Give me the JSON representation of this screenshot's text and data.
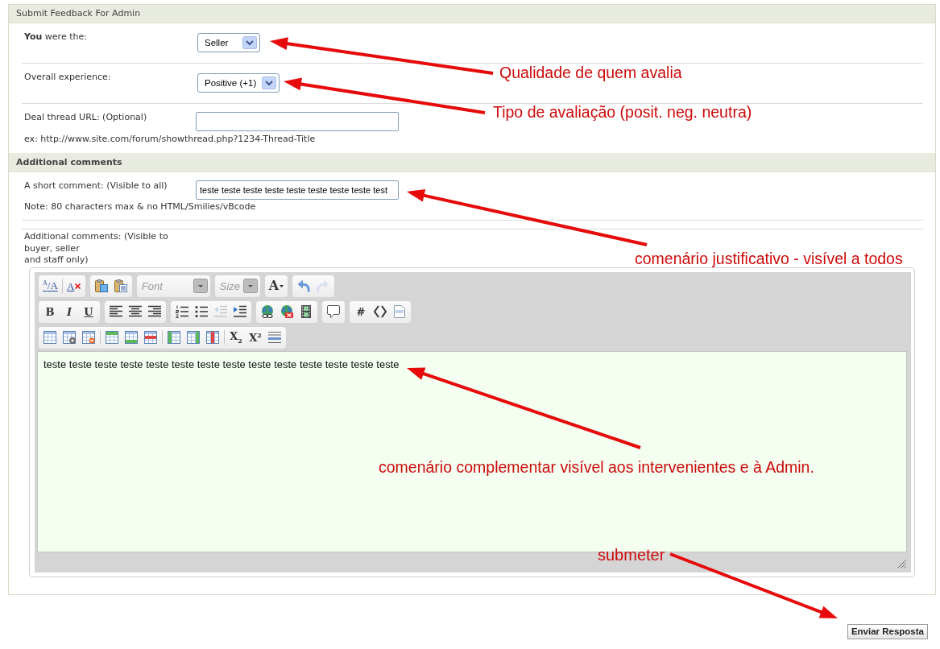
{
  "panel": {
    "title": "Submit Feedback For Admin"
  },
  "fields": [
    {
      "kind": "select",
      "label": "**You** were the:",
      "value": "Seller"
    },
    {
      "kind": "select",
      "label": "Overall experience:",
      "value": "Positive (+1)"
    },
    {
      "kind": "text",
      "label": "Deal thread URL: (Optional)",
      "hint": "ex: http://www.site.com/forum/showthread.php?1234-Thread-Title"
    }
  ],
  "section": {
    "title": "Additional comments"
  },
  "short_comment": {
    "label": "A short comment: (Visible to all)",
    "value": "teste teste teste teste teste teste teste teste test",
    "note": "Note: 80 characters max & no HTML/Smilies/vBcode"
  },
  "additional_comments": {
    "label_lines": [
      "Additional comments: (Visible to",
      "buyer, seller",
      "and staff only)"
    ],
    "editor": {
      "toolbar": [
        [
          {
            "sections": [
              [
                {
                  "kind": "fontsize",
                  "text": "$^{A}$/A",
                  "disabled": false
                }
              ],
              [
                {
                  "kind": "unformat",
                  "text": "A",
                  "disabled": false
                }
              ]
            ]
          },
          {
            "sections": [
              [
                {
                  "kind": "icon",
                  "disabled": false
                },
                {
                  "kind": "icon",
                  "disabled": false
                }
              ]
            ]
          },
          {
            "sections": [
              [
                {
                  "kind": "dropdown",
                  "placeholder": "Font",
                  "disabled": false
                }
              ]
            ]
          },
          {
            "sections": [
              [
                {
                  "kind": "dropdown",
                  "placeholder": "Size",
                  "disabled": false
                }
              ]
            ]
          },
          {
            "sections": [
              [
                {
                  "kind": "color",
                  "text": "A",
                  "disabled": false
                }
              ]
            ]
          },
          {
            "sections": [
              [
                {
                  "kind": "icon",
                  "disabled": false
                },
                {
                  "kind": "icon",
                  "disabled": true
                }
              ]
            ]
          }
        ],
        [
          {
            "sections": [
              [
                {
                  "kind": "bold",
                  "text": "B",
                  "disabled": false
                },
                {
                  "kind": "italic",
                  "text": "I",
                  "disabled": false
                },
                {
                  "kind": "underline",
                  "text": "U",
                  "disabled": false
                }
              ]
            ]
          },
          {
            "sections": [
              [
                {
                  "kind": "icon",
                  "disabled": false
                },
                {
                  "kind": "icon",
                  "disabled": false
                },
                {
                  "kind": "icon",
                  "disabled": false
                }
              ]
            ]
          },
          {
            "sections": [
              [
                {
                  "kind": "icon",
                  "disabled": false
                },
                {
                  "kind": "icon",
                  "disabled": false
                },
                {
                  "kind": "icon",
                  "disabled": true
                },
                {
                  "kind": "icon",
                  "disabled": false
                }
              ]
            ]
          },
          {
            "sections": [
              [
                {
                  "kind": "icon",
                  "disabled": false
                },
                {
                  "kind": "icon",
                  "disabled": false
                },
                {
                  "kind": "icon",
                  "disabled": false
                }
              ]
            ]
          },
          {
            "sections": [
              [
                {
                  "kind": "icon",
                  "disabled": false
                }
              ]
            ]
          },
          {
            "sections": [
              [
                {
                  "kind": "letter",
                  "text": "#",
                  "disabled": false
                },
                {
                  "kind": "icon",
                  "disabled": false
                },
                {
                  "kind": "icon",
                  "disabled": false
                }
              ]
            ]
          }
        ],
        [
          {
            "sections": [
              [
                {
                  "kind": "icon",
                  "disabled": false
                },
                {
                  "kind": "icon",
                  "disabled": false
                },
                {
                  "kind": "icon",
                  "disabled": false
                }
              ],
              [
                {
                  "kind": "icon",
                  "disabled": false
                },
                {
                  "kind": "icon",
                  "disabled": false
                },
                {
                  "kind": "icon",
                  "disabled": false
                }
              ],
              [
                {
                  "kind": "icon",
                  "disabled": false
                },
                {
                  "kind": "icon",
                  "disabled": false
                },
                {
                  "kind": "icon",
                  "disabled": false
                }
              ],
              [
                {
                  "kind": "letter",
                  "text": "X$_{2}$",
                  "disabled": false
                },
                {
                  "kind": "letter",
                  "text": "X$^{2}$",
                  "disabled": false
                },
                {
                  "kind": "icon",
                  "disabled": false
                }
              ]
            ]
          }
        ]
      ],
      "content": "teste teste teste teste teste teste teste teste teste teste teste teste teste teste"
    }
  },
  "submit_button": {
    "label": "Enviar Resposta"
  },
  "annotations": [
    {
      "text": "Qualidade de quem avalia"
    },
    {
      "text": "Tipo de avaliação (posit. neg. neutra)"
    },
    {
      "text": "comenário justificativo - visível a todos"
    },
    {
      "text": "comenário complementar visível aos intervenientes e à Admin."
    },
    {
      "text": "submeter"
    }
  ]
}
